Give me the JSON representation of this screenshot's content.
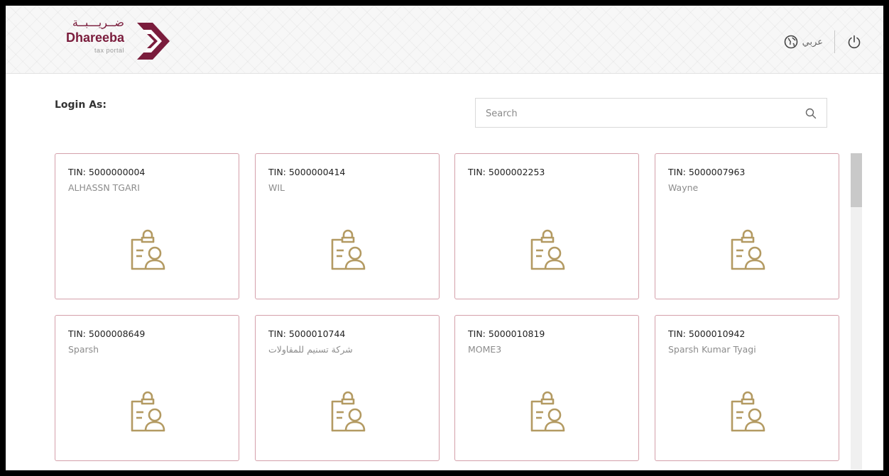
{
  "brand": {
    "arabic_name": "ضــريـــبــة",
    "name": "Dhareeba",
    "tagline": "tax portal",
    "color": "#7a1c3c"
  },
  "header": {
    "language_label": "عربي",
    "globe_icon": "globe-icon",
    "logout_icon": "power-icon"
  },
  "main": {
    "title": "Login As:",
    "search_placeholder": "Search",
    "search_icon": "search-icon"
  },
  "accounts": [
    {
      "tin": "TIN: 5000000004",
      "name": "ALHASSN TGARI"
    },
    {
      "tin": "TIN: 5000000414",
      "name": "WIL"
    },
    {
      "tin": "TIN: 5000002253",
      "name": ""
    },
    {
      "tin": "TIN: 5000007963",
      "name": "Wayne"
    },
    {
      "tin": "TIN: 5000008649",
      "name": "Sparsh"
    },
    {
      "tin": "TIN: 5000010744",
      "name": "شركة تسنيم للمقاولات"
    },
    {
      "tin": "TIN: 5000010819",
      "name": "MOME3"
    },
    {
      "tin": "TIN: 5000010942",
      "name": "Sparsh Kumar Tyagi"
    }
  ],
  "card_icon": "taxpayer-profile-icon",
  "colors": {
    "card_border": "#d4a0aa",
    "icon_gold": "#b39a62"
  }
}
